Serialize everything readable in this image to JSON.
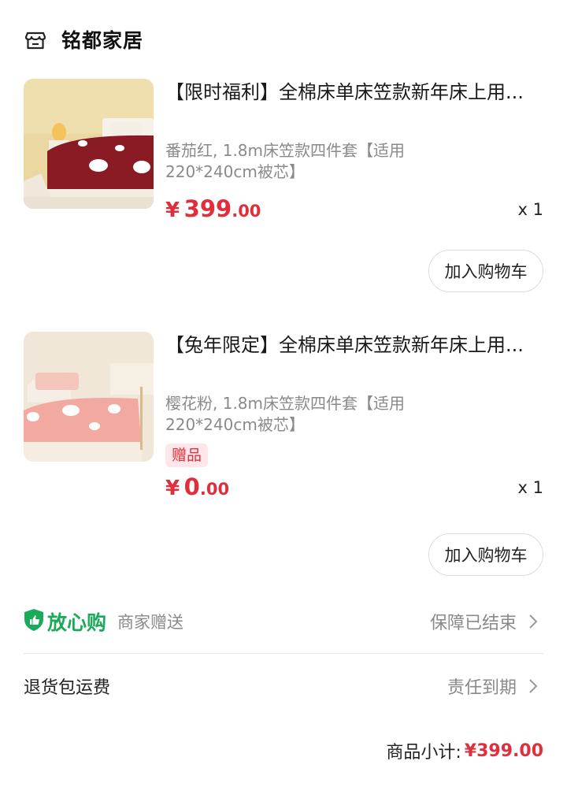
{
  "shop": {
    "name": "铭都家居",
    "icon": "store-icon"
  },
  "items": [
    {
      "title": "【限时福利】全棉床单床笠款新年床上用...",
      "spec": "番茄红, 1.8m床笠款四件套【适用220*240cm被芯】",
      "price_currency": "¥",
      "price_int": "399",
      "price_dec": ".00",
      "quantity": "x 1",
      "cart_button": "加入购物车",
      "thumb_colors": {
        "bed": "#8a1a23",
        "wall": "#e8d49a",
        "pattern": "#ffffff"
      }
    },
    {
      "title": "【兔年限定】全棉床单床笠款新年床上用...",
      "spec": "樱花粉, 1.8m床笠款四件套【适用220*240cm被芯】",
      "badge": "赠品",
      "price_currency": "¥",
      "price_int": "0",
      "price_dec": ".00",
      "quantity": "x 1",
      "cart_button": "加入购物车",
      "thumb_colors": {
        "bed": "#f2a9a0",
        "wall": "#f0e6d6",
        "pattern": "#ffffff"
      }
    }
  ],
  "guarantee": {
    "brand": "放心购",
    "note": "商家赠送",
    "status": "保障已结束"
  },
  "shipping": {
    "label": "退货包运费",
    "status": "责任到期"
  },
  "subtotal": {
    "label": "商品小计:",
    "value": "¥399.00"
  },
  "colors": {
    "accent_red": "#e02e3c",
    "guarantee_green": "#1aaa5a",
    "muted_gray": "#8a8a8a"
  }
}
